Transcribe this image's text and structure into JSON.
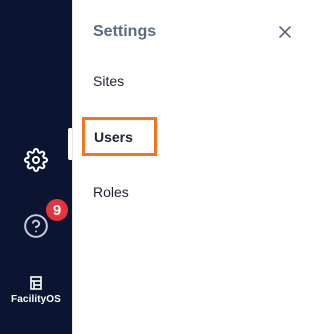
{
  "rail": {
    "items": [
      {
        "name": "settings",
        "icon": "gear-icon"
      },
      {
        "name": "help",
        "icon": "question-circle-icon",
        "badge": "9"
      }
    ],
    "brand": {
      "name": "FacilityOS",
      "logo": "facilityos-logo-icon"
    }
  },
  "panel": {
    "title": "Settings",
    "close_icon": "close-icon",
    "items": [
      {
        "label": "Sites"
      },
      {
        "label": "Users",
        "selected": true
      },
      {
        "label": "Roles"
      }
    ]
  },
  "colors": {
    "rail_background": "#0b1430",
    "badge": "#e5343a",
    "highlight_border": "#f07621",
    "panel_title": "#5b6b82"
  }
}
